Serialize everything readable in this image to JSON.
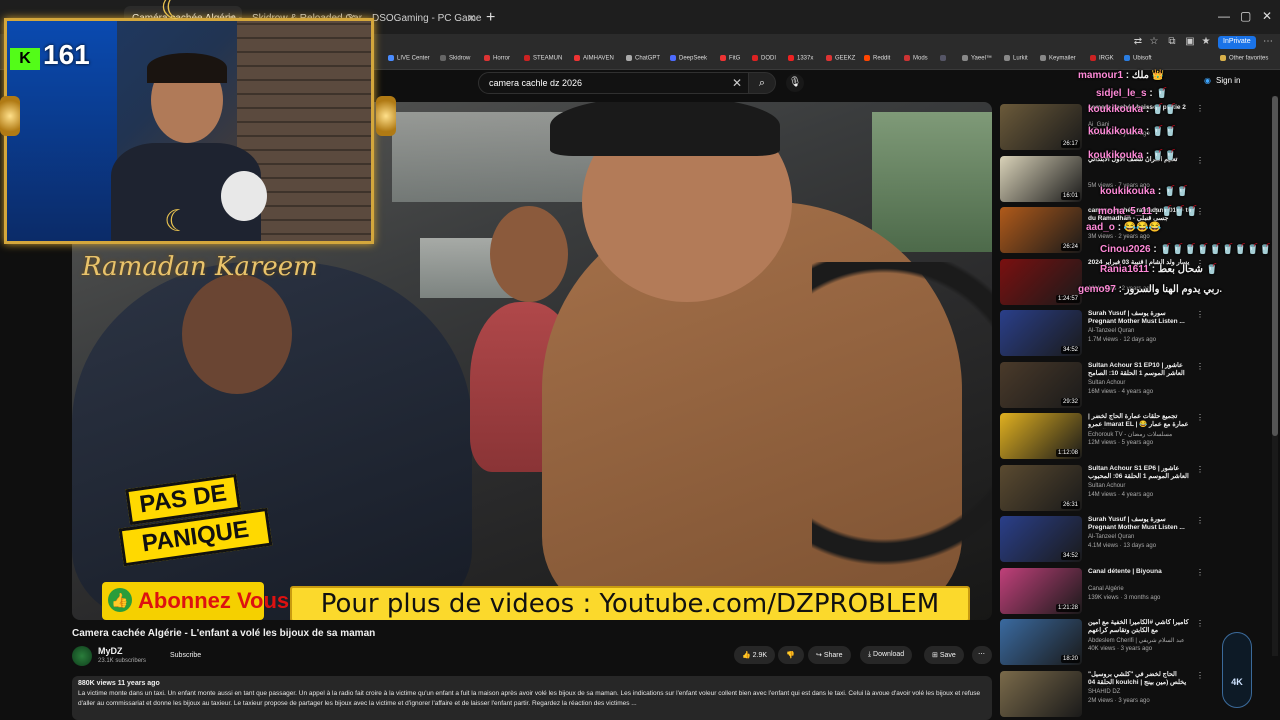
{
  "browser": {
    "tabs": [
      {
        "label": "Caméra cachée Algérie - L'enfan",
        "active": true
      },
      {
        "label": "Skidrow & Reloaded Games"
      },
      {
        "label": "DSOGaming - PC Games News, S"
      }
    ],
    "inprivate_label": "InPrivate",
    "favorites": [
      "LIVE Center",
      "Skidrow",
      "Horror",
      "STEAMUN",
      "AIMHAVEN",
      "ChatGPT",
      "DeepSeek",
      "FitG",
      "DODI",
      "1337x",
      "GEEKZ",
      "Reddit",
      "Mods",
      "Yaeel™",
      "Lurkit",
      "Keymailer",
      "IRGK",
      "Ubisoft"
    ],
    "other_favorites": "Other favorites"
  },
  "youtube": {
    "search_value": "camera cachle dz 2026",
    "signin_label": "Sign in"
  },
  "stream": {
    "viewer_count": "161",
    "kick_logo": "K",
    "ramadan_text": "Ramadan Kareem"
  },
  "video_overlay": {
    "pas_de_line1": "PAS DE",
    "pas_de_line2": "PANIQUE",
    "abonnez": "Abonnez Vous",
    "banner": "Pour plus de videos : Youtube.com/DZPROBLEM"
  },
  "chat": [
    {
      "user": "mamour1",
      "text": ": ملك 👑"
    },
    {
      "user": "sidjel_le_s",
      "text": ": 🥤"
    },
    {
      "user": "koukikouka",
      "text": ": 🥤🥤"
    },
    {
      "user": "koukikouka",
      "text": ": 🥤🥤"
    },
    {
      "user": "koukikouka",
      "text": ": 🥤🥤"
    },
    {
      "user": "koukikouka",
      "text": ": 🥤🥤"
    },
    {
      "user": "moha_5_11",
      "text": ": 🥤🥤🥤"
    },
    {
      "user": "aad_o",
      "text": ": 😂😂😂"
    },
    {
      "user": "Cinou2026",
      "text": ": 🥤🥤🥤🥤🥤🥤🥤🥤🥤"
    },
    {
      "user": "Rania1611",
      "text": ": شحال بعط 🥤"
    },
    {
      "user": "gemo97",
      "text": ": ربي يدوم الهنا والسرور."
    }
  ],
  "recommendations": [
    {
      "title": "camera cachée haissou partie 2",
      "channel": "Ai_Gani",
      "meta": "1M views · 8 years ago",
      "duration": "26:17",
      "thumb": "#6b5a3a"
    },
    {
      "title": "تعليم القرآن للصف الأول الابتدائي",
      "channel": "",
      "meta": "5M views · 7 years ago",
      "duration": "16:01",
      "thumb": "#d9d2b8"
    },
    {
      "title": "camera cachée ramadan 2013 - tu du Ramadhan - جسي قنبلي",
      "channel": "",
      "meta": "3M views · 2 years ago",
      "duration": "26:24",
      "thumb": "#b05a1a"
    },
    {
      "title": "يسار ولد الشام | قنيبة 03 فبراير 2024",
      "channel": "",
      "meta": "10M views · 2 years ago",
      "duration": "1:24:57",
      "thumb": "#7a1010"
    },
    {
      "title": "Surah Yusuf | سورة يوسف Pregnant Mother Must Listen ...",
      "channel": "Al-Tanzeel Quran",
      "meta": "1.7M views · 12 days ago",
      "duration": "34:52",
      "thumb": "#2a3f8a"
    },
    {
      "title": "Sultan Achour S1 EP10 | عاشور العاشر الموسم 1 الحلقة 10: الصامح",
      "channel": "Sultan Achour",
      "meta": "16M views · 4 years ago",
      "duration": "29:32",
      "thumb": "#4a3a2a"
    },
    {
      "title": "تجميع حلقات عمارة الحاج لخضر | عمرو Imarat EL | 😂 عمارة مع عمار والسعيد",
      "channel": "Echorouk TV - مسلسلات رمضان",
      "meta": "12M views · 5 years ago",
      "duration": "1:12:08",
      "thumb": "#e0b020"
    },
    {
      "title": "Sultan Achour S1 EP6 | عاشور العاشر الموسم 1 الحلقة 06: المحبوب",
      "channel": "Sultan Achour",
      "meta": "14M views · 4 years ago",
      "duration": "26:31",
      "thumb": "#5a4a30"
    },
    {
      "title": "Surah Yusuf | سورة يوسف Pregnant Mother Must Listen ...",
      "channel": "Al-Tanzeel Quran",
      "meta": "4.1M views · 13 days ago",
      "duration": "34:52",
      "thumb": "#2a3f8a"
    },
    {
      "title": "Canal détente | Biyouna",
      "channel": "Canal Algérie",
      "meta": "139K views · 3 months ago",
      "duration": "1:21:28",
      "thumb": "#c0407a"
    },
    {
      "title": "كاميرا كاشي #الكاميرا الخفية مع أمين مع الكابتن وتقاسم كراعهم",
      "channel": "Abdeslem Cherifi | عبد السلام شريفي",
      "meta": "40K views · 3 years ago",
      "duration": "18:20",
      "thumb": "#3a6aa0"
    },
    {
      "title": "الحاج لخضر في \"كلشي بروسيل\" الحلقة 04 koulchi | يخلص (مين بينج في الكاميرا)",
      "channel": "SHAHID DZ",
      "meta": "2M views · 3 years ago",
      "duration": "",
      "thumb": "#7a6a4a"
    }
  ],
  "video": {
    "title": "Camera cachée Algérie - L'enfant a volé les bijoux de sa maman",
    "channel": "MyDZ",
    "subscribers": "23.1K subscribers",
    "subscribe_label": "Subscribe",
    "likes": "2.9K",
    "share_label": "Share",
    "download_label": "Download",
    "save_label": "Save",
    "views_time": "880K views  11 years ago",
    "description": "La victime monte dans un taxi. Un enfant monte aussi en tant que passager. Un appel à la radio fait croire à la victime qu'un enfant a fuit la maison après avoir volé les bijoux de sa maman. Les indications sur l'enfant voleur collent bien avec l'enfant qui est dans le taxi. Celui là avoue d'avoir volé les bijoux et refuse d'aller au commissariat et donne les bijoux au taxieur. Le taxieur propose de partager les bijoux avec la victime et d'ignorer l'affaire et de laisser l'enfant partir. Regardez la réaction des victimes ..."
  },
  "badge_label": "4K"
}
